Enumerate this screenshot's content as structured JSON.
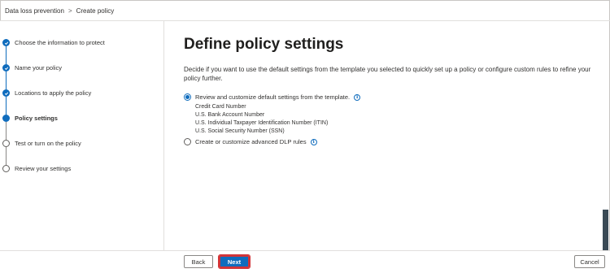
{
  "breadcrumb": {
    "items": [
      "Data loss prevention",
      "Create policy"
    ]
  },
  "sidebar": {
    "steps": [
      {
        "label": "Choose the information to protect",
        "state": "done"
      },
      {
        "label": "Name your policy",
        "state": "done"
      },
      {
        "label": "Locations to apply the policy",
        "state": "done"
      },
      {
        "label": "Policy settings",
        "state": "current"
      },
      {
        "label": "Test or turn on the policy",
        "state": "todo"
      },
      {
        "label": "Review your settings",
        "state": "todo"
      }
    ]
  },
  "main": {
    "title": "Define policy settings",
    "description": "Decide if you want to use the default settings from the template you selected to quickly set up a policy or configure custom rules to refine your policy further.",
    "options": [
      {
        "label": "Review and customize default settings from the template.",
        "selected": true,
        "info_icon": "info-icon",
        "sub_items": [
          "Credit Card Number",
          "U.S. Bank Account Number",
          "U.S. Individual Taxpayer Identification Number (ITIN)",
          "U.S. Social Security Number (SSN)"
        ]
      },
      {
        "label": "Create or customize advanced DLP rules",
        "selected": false,
        "info_icon": "info-icon"
      }
    ]
  },
  "footer": {
    "back_label": "Back",
    "next_label": "Next",
    "cancel_label": "Cancel"
  },
  "colors": {
    "accent": "#0f6cbd",
    "highlight_border": "#d13438"
  }
}
